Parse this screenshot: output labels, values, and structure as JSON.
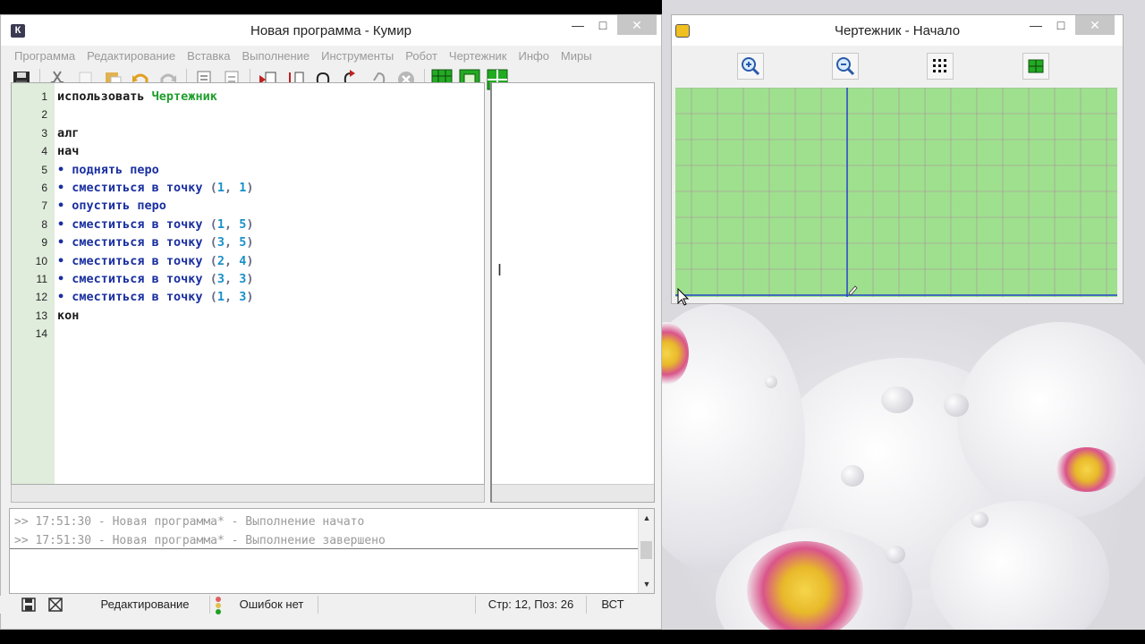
{
  "main_window": {
    "title": "Новая программа - Кумир",
    "app_icon": "К",
    "menu": [
      "Программа",
      "Редактирование",
      "Вставка",
      "Выполнение",
      "Инструменты",
      "Робот",
      "Чертежник",
      "Инфо",
      "Миры"
    ]
  },
  "toolbar_icons": [
    "save-icon",
    "cut-icon",
    "copy-icon",
    "paste-icon",
    "undo-icon",
    "redo-icon",
    "insert-algorithm-icon",
    "insert-line-icon",
    "run-icon",
    "step-over-icon",
    "step-into-icon",
    "step-out-icon",
    "stop-icon",
    "robot-field-icon",
    "drawer-window-icon",
    "grid-icon"
  ],
  "editor": {
    "lines": [
      {
        "n": "1",
        "parts": [
          {
            "t": "использовать ",
            "c": "kw"
          },
          {
            "t": "Чертежник",
            "c": "lib"
          }
        ]
      },
      {
        "n": "2",
        "parts": []
      },
      {
        "n": "3",
        "parts": [
          {
            "t": "алг",
            "c": "kw"
          }
        ]
      },
      {
        "n": "4",
        "parts": [
          {
            "t": "нач",
            "c": "kw"
          }
        ]
      },
      {
        "n": "5",
        "parts": [
          {
            "t": "• ",
            "c": "dot"
          },
          {
            "t": "поднять перо",
            "c": "cmd"
          }
        ]
      },
      {
        "n": "6",
        "parts": [
          {
            "t": "• ",
            "c": "dot"
          },
          {
            "t": "сместиться в точку ",
            "c": "cmd"
          },
          {
            "t": "(",
            "c": "par"
          },
          {
            "t": "1",
            "c": "num"
          },
          {
            "t": ", ",
            "c": "par"
          },
          {
            "t": "1",
            "c": "num"
          },
          {
            "t": ")",
            "c": "par"
          }
        ]
      },
      {
        "n": "7",
        "parts": [
          {
            "t": "• ",
            "c": "dot"
          },
          {
            "t": "опустить перо",
            "c": "cmd"
          }
        ]
      },
      {
        "n": "8",
        "parts": [
          {
            "t": "• ",
            "c": "dot"
          },
          {
            "t": "сместиться в точку ",
            "c": "cmd"
          },
          {
            "t": "(",
            "c": "par"
          },
          {
            "t": "1",
            "c": "num"
          },
          {
            "t": ", ",
            "c": "par"
          },
          {
            "t": "5",
            "c": "num"
          },
          {
            "t": ")",
            "c": "par"
          }
        ]
      },
      {
        "n": "9",
        "parts": [
          {
            "t": "• ",
            "c": "dot"
          },
          {
            "t": "сместиться в точку ",
            "c": "cmd"
          },
          {
            "t": "(",
            "c": "par"
          },
          {
            "t": "3",
            "c": "num"
          },
          {
            "t": ", ",
            "c": "par"
          },
          {
            "t": "5",
            "c": "num"
          },
          {
            "t": ")",
            "c": "par"
          }
        ]
      },
      {
        "n": "10",
        "parts": [
          {
            "t": "• ",
            "c": "dot"
          },
          {
            "t": "сместиться в точку ",
            "c": "cmd"
          },
          {
            "t": "(",
            "c": "par"
          },
          {
            "t": "2",
            "c": "num"
          },
          {
            "t": ", ",
            "c": "par"
          },
          {
            "t": "4",
            "c": "num"
          },
          {
            "t": ")",
            "c": "par"
          }
        ]
      },
      {
        "n": "11",
        "parts": [
          {
            "t": "• ",
            "c": "dot"
          },
          {
            "t": "сместиться в точку ",
            "c": "cmd"
          },
          {
            "t": "(",
            "c": "par"
          },
          {
            "t": "3",
            "c": "num"
          },
          {
            "t": ", ",
            "c": "par"
          },
          {
            "t": "3",
            "c": "num"
          },
          {
            "t": ")",
            "c": "par"
          }
        ]
      },
      {
        "n": "12",
        "parts": [
          {
            "t": "• ",
            "c": "dot"
          },
          {
            "t": "сместиться в точку ",
            "c": "cmd"
          },
          {
            "t": "(",
            "c": "par"
          },
          {
            "t": "1",
            "c": "num"
          },
          {
            "t": ", ",
            "c": "par"
          },
          {
            "t": "3",
            "c": "num"
          },
          {
            "t": ")",
            "c": "par"
          }
        ]
      },
      {
        "n": "13",
        "parts": [
          {
            "t": "кон",
            "c": "kw"
          }
        ]
      },
      {
        "n": "14",
        "parts": []
      }
    ]
  },
  "console": {
    "lines": [
      ">> 17:51:30 - Новая программа* - Выполнение начато",
      ">> 17:51:30 - Новая программа* - Выполнение завершено"
    ]
  },
  "statusbar": {
    "mode": "Редактирование",
    "errors": "Ошибок нет",
    "position": "Стр: 12, Поз: 26",
    "insert_mode": "ВСТ"
  },
  "drawer_window": {
    "title": "Чертежник - Начало",
    "tools": [
      "zoom-in-icon",
      "zoom-out-icon",
      "grid-dots-icon",
      "fit-view-icon"
    ]
  },
  "colors": {
    "canvas_bg": "#9ee08e",
    "grid_line": "#b08aa0",
    "axis": "#2244cc",
    "keyword": "#1a1a1a",
    "library": "#1f9e2c",
    "command": "#1a2fa0",
    "number": "#1a90c8"
  }
}
